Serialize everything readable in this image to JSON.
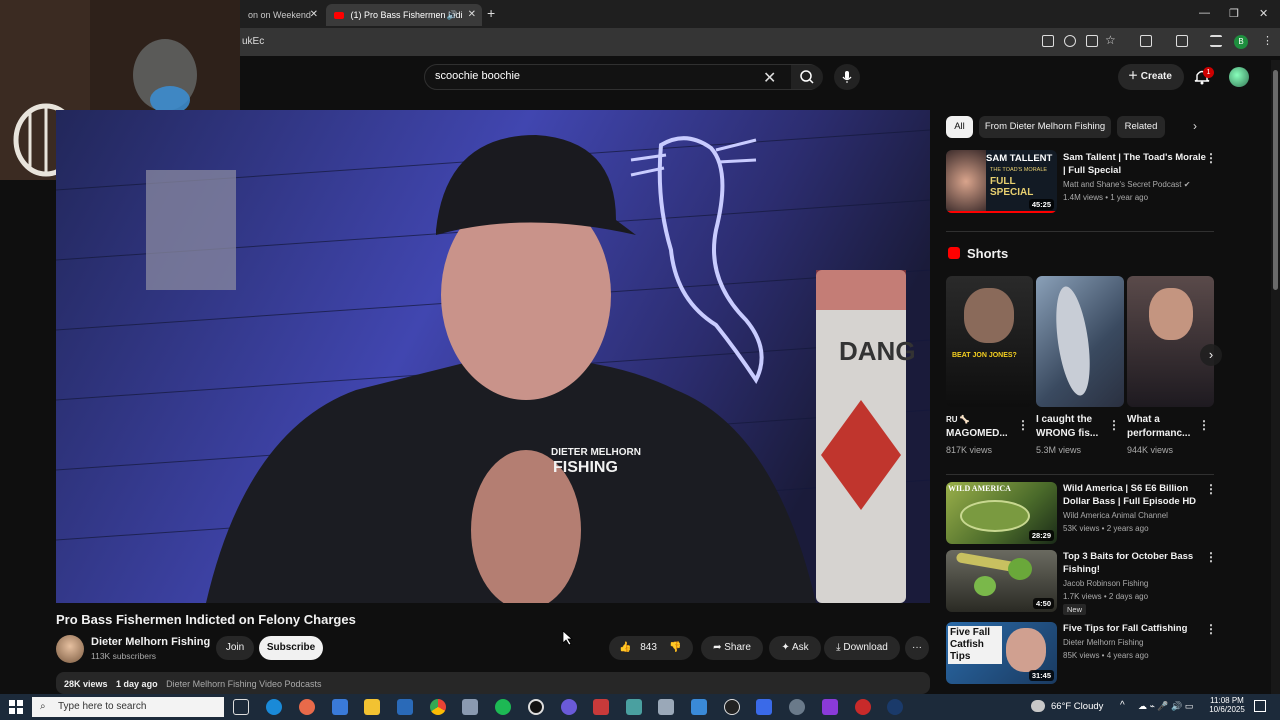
{
  "browser": {
    "tabs": [
      {
        "label": "on on Weekend",
        "active": false
      },
      {
        "label": "(1) Pro Bass Fishermen Indi",
        "active": true
      }
    ],
    "new_tab_symbol": "+",
    "address_fragment": "ukEc",
    "profile_letter": "B"
  },
  "header": {
    "search_value": "scoochie boochie",
    "create_label": "Create",
    "notification_count": "1"
  },
  "video": {
    "title": "Pro Bass Fishermen Indicted on Felony Charges",
    "overlay_text": {
      "shirt_line1": "DIETER MELHORN",
      "shirt_line2": "FISHING",
      "sign_text": "DANG"
    }
  },
  "channel": {
    "name": "Dieter Melhorn Fishing",
    "subscribers": "113K subscribers",
    "join_label": "Join",
    "subscribe_label": "Subscribe"
  },
  "actions": {
    "like_count": "843",
    "share_label": "Share",
    "ask_label": "Ask",
    "download_label": "Download"
  },
  "description": {
    "views": "28K views",
    "age": "1 day ago",
    "playlist": "Dieter Melhorn Fishing Video Podcasts"
  },
  "chips": [
    "All",
    "From Dieter Melhorn Fishing",
    "Related"
  ],
  "recommendations_top": {
    "title_line1": "Sam Tallent | The Toad's Morale",
    "title_line2": "| Full Special",
    "channel": "Matt and Shane's Secret Podcast",
    "meta": "1.4M views • 1 year ago",
    "duration": "45:25",
    "thumb_text": {
      "line1": "SAM TALLENT",
      "line2": "THE TOAD'S MORALE",
      "line3": "FULL SPECIAL"
    }
  },
  "shorts": {
    "heading": "Shorts",
    "items": [
      {
        "title_line1": "RU 🦴",
        "title_line2": "MAGOMED...",
        "views": "817K views",
        "thumb_text": "BEAT JON JONES?"
      },
      {
        "title_line1": "I caught the",
        "title_line2": "WRONG fis...",
        "views": "5.3M views"
      },
      {
        "title_line1": "What a",
        "title_line2": "performanc...",
        "views": "944K views"
      }
    ]
  },
  "recommendations": [
    {
      "title_line1": "Wild America | S6 E6 Billion",
      "title_line2": "Dollar Bass | Full Episode HD",
      "channel": "Wild America Animal Channel",
      "meta": "53K views • 2 years ago",
      "duration": "28:29",
      "badge": "",
      "thumb_label": "WILD AMERICA"
    },
    {
      "title_line1": "Top 3 Baits for October Bass",
      "title_line2": "Fishing!",
      "channel": "Jacob Robinson Fishing",
      "meta": "1.7K views • 2 days ago",
      "duration": "4:50",
      "badge": "New",
      "thumb_label": ""
    },
    {
      "title_line1": "Five Tips for Fall Catfishing",
      "title_line2": "",
      "channel": "Dieter Melhorn Fishing",
      "meta": "85K views • 4 years ago",
      "duration": "31:45",
      "badge": "",
      "thumb_label": "Five Fall Catfish Tips"
    }
  ],
  "taskbar": {
    "search_placeholder": "Type here to search",
    "weather": "66°F  Cloudy",
    "time": "11:08 PM",
    "date": "10/6/2025"
  },
  "colors": {
    "bg": "#0f0f0f",
    "accent_red": "#ff0000",
    "chip_bg": "#272727",
    "taskbar": "#1c2a3a"
  }
}
